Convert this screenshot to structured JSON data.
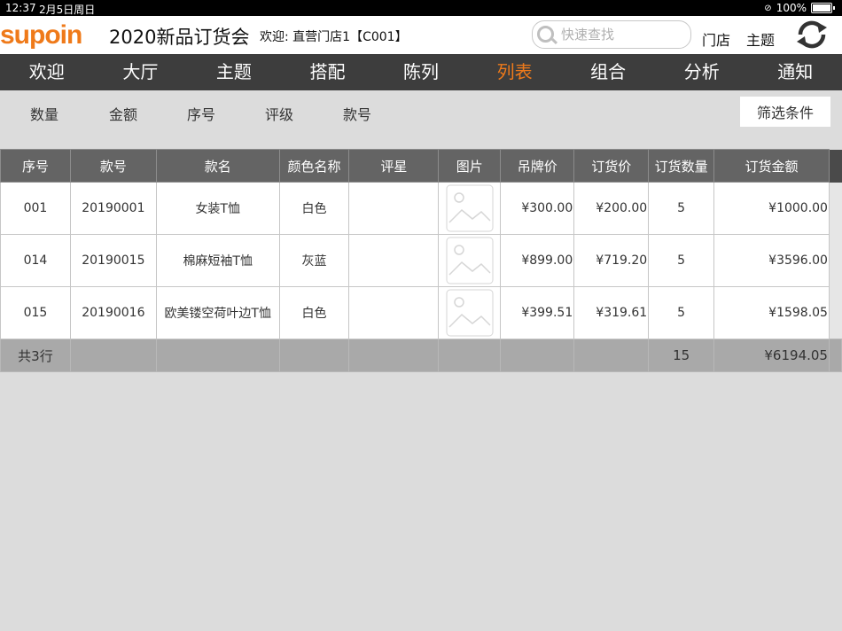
{
  "status": {
    "time": "12:37",
    "date": "2月5日周日",
    "battery": "100%"
  },
  "header": {
    "logo": "supoin",
    "event_title": "2020新品订货会",
    "welcome": "欢迎: 直营门店1【C001】",
    "search_placeholder": "快速查找",
    "store_link": "门店",
    "theme_link": "主题"
  },
  "nav": {
    "tabs": [
      "欢迎",
      "大厅",
      "主题",
      "搭配",
      "陈列",
      "列表",
      "组合",
      "分析",
      "通知"
    ],
    "active": "列表"
  },
  "sortbar": {
    "options": [
      "数量",
      "金额",
      "序号",
      "评级",
      "款号"
    ],
    "filter_label": "筛选条件"
  },
  "table": {
    "columns": [
      "序号",
      "款号",
      "款名",
      "颜色名称",
      "评星",
      "图片",
      "吊牌价",
      "订货价",
      "订货数量",
      "订货金额"
    ],
    "rows": [
      {
        "seq": "001",
        "code": "20190001",
        "name": "女装T恤",
        "color": "白色",
        "rating": "",
        "tag_price": "¥300.00",
        "order_price": "¥200.00",
        "qty": "5",
        "amount": "¥1000.00"
      },
      {
        "seq": "014",
        "code": "20190015",
        "name": "棉麻短袖T恤",
        "color": "灰蓝",
        "rating": "",
        "tag_price": "¥899.00",
        "order_price": "¥719.20",
        "qty": "5",
        "amount": "¥3596.00"
      },
      {
        "seq": "015",
        "code": "20190016",
        "name": "欧美镂空荷叶边T恤",
        "color": "白色",
        "rating": "",
        "tag_price": "¥399.51",
        "order_price": "¥319.61",
        "qty": "5",
        "amount": "¥1598.05"
      }
    ],
    "total": {
      "label": "共3行",
      "qty": "15",
      "amount": "¥6194.05"
    }
  },
  "colors": {
    "accent": "#ef7a1a",
    "nav_bg": "#3d3d3d",
    "header_row": "#646464"
  }
}
